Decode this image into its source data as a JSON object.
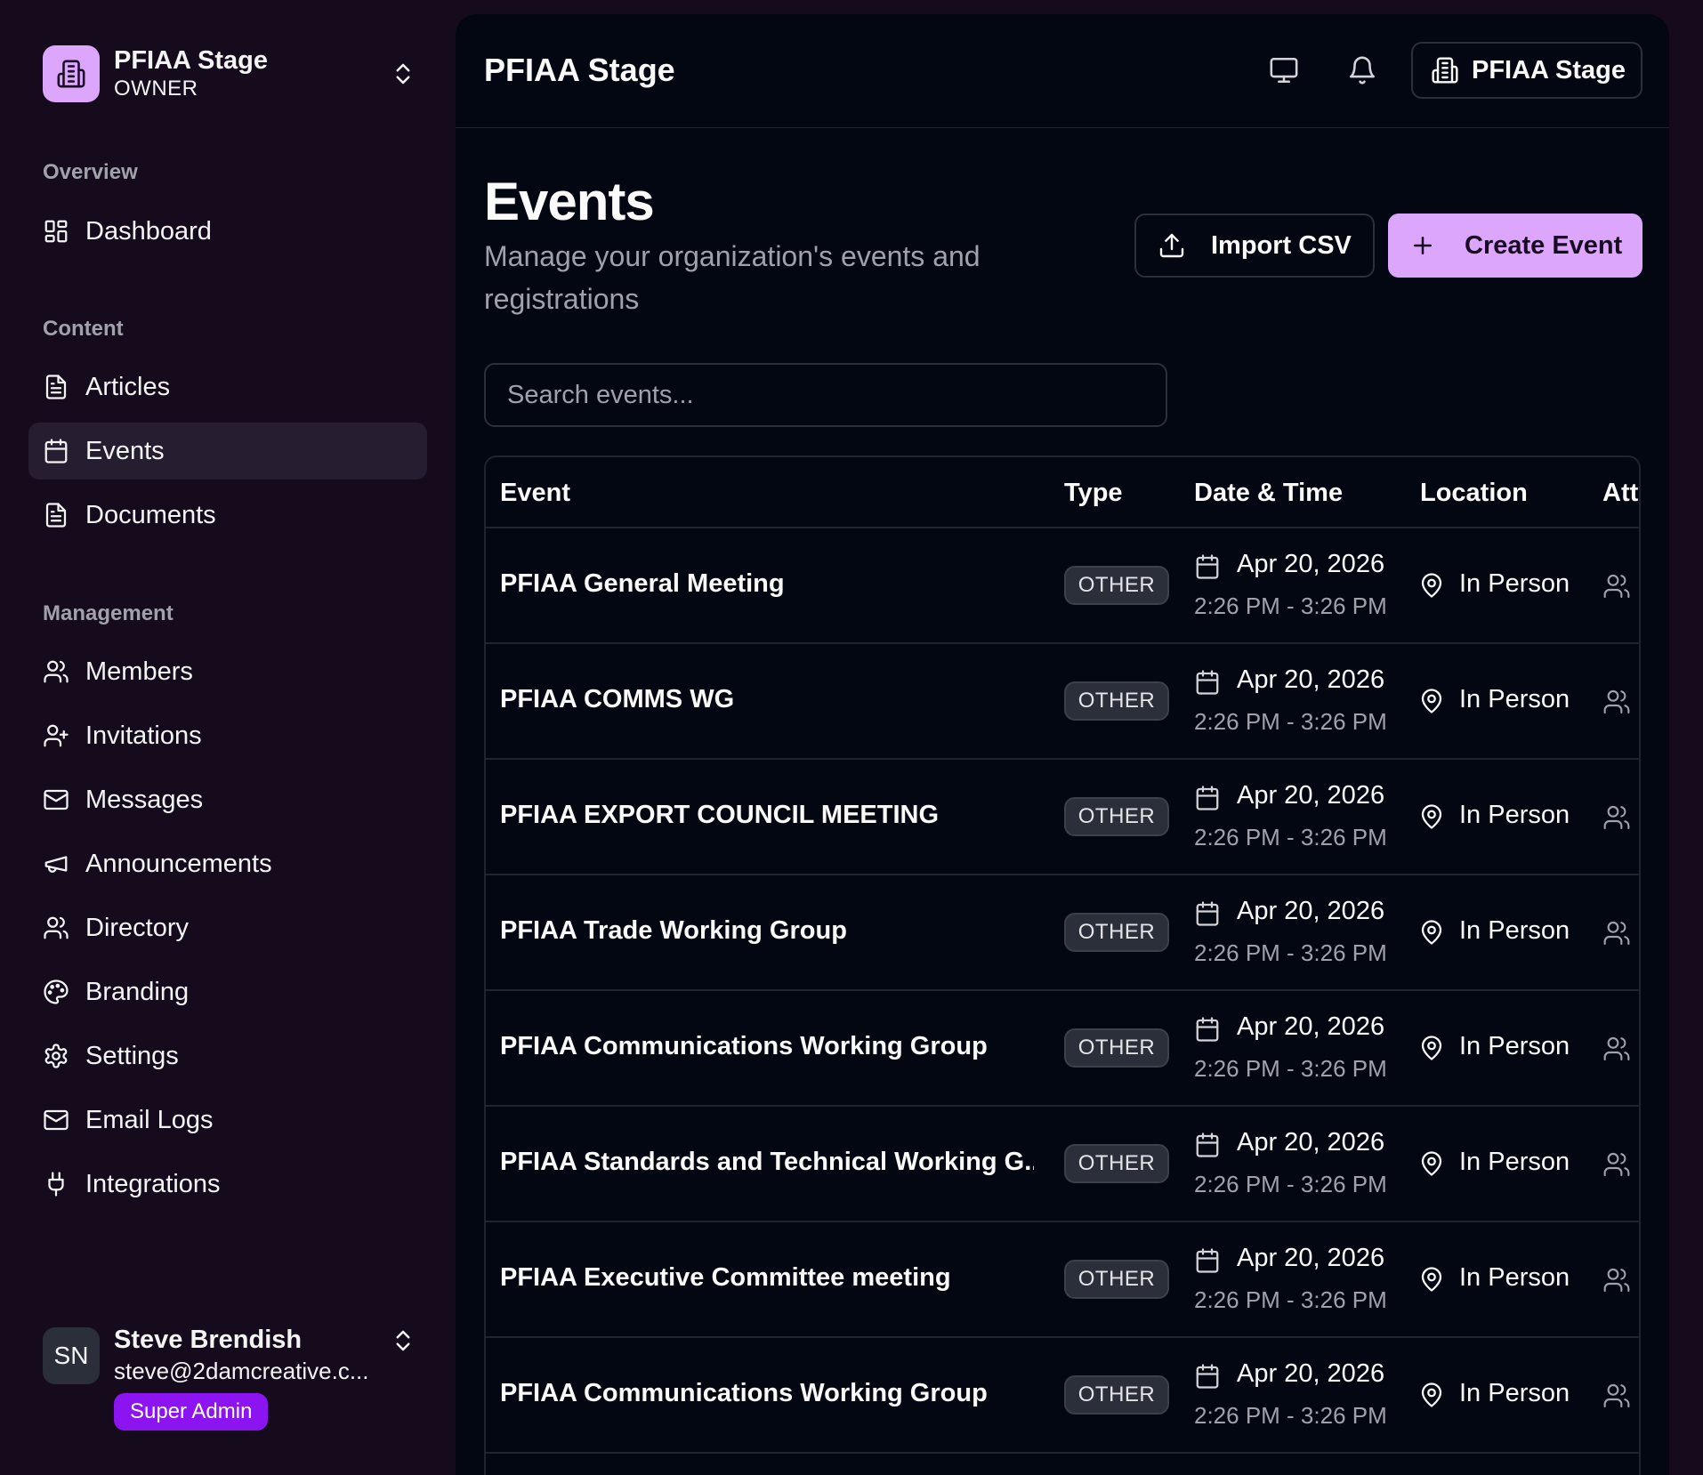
{
  "org": {
    "name": "PFIAA Stage",
    "role": "OWNER"
  },
  "nav": {
    "overview_label": "Overview",
    "content_label": "Content",
    "management_label": "Management",
    "dashboard": "Dashboard",
    "articles": "Articles",
    "events": "Events",
    "documents": "Documents",
    "members": "Members",
    "invitations": "Invitations",
    "messages": "Messages",
    "announcements": "Announcements",
    "directory": "Directory",
    "branding": "Branding",
    "settings": "Settings",
    "email_logs": "Email Logs",
    "integrations": "Integrations",
    "active": "events"
  },
  "user": {
    "initials": "SN",
    "name": "Steve Brendish",
    "email": "steve@2damcreative.c...",
    "badge": "Super Admin"
  },
  "header": {
    "title": "PFIAA Stage",
    "org_button": "PFIAA Stage",
    "icons": [
      "monitor-icon",
      "bell-icon",
      "building-icon"
    ]
  },
  "page": {
    "title": "Events",
    "subtitle": "Manage your organization's events and registrations",
    "import_label": "Import CSV",
    "create_label": "Create Event",
    "search_placeholder": "Search events..."
  },
  "table": {
    "columns": [
      "Event",
      "Type",
      "Date & Time",
      "Location",
      "Att"
    ],
    "rows": [
      {
        "name": "PFIAA General Meeting",
        "type": "OTHER",
        "date": "Apr 20, 2026",
        "time": "2:26 PM - 3:26 PM",
        "location": "In Person"
      },
      {
        "name": "PFIAA COMMS WG",
        "type": "OTHER",
        "date": "Apr 20, 2026",
        "time": "2:26 PM - 3:26 PM",
        "location": "In Person"
      },
      {
        "name": "PFIAA EXPORT COUNCIL MEETING",
        "type": "OTHER",
        "date": "Apr 20, 2026",
        "time": "2:26 PM - 3:26 PM",
        "location": "In Person"
      },
      {
        "name": "PFIAA Trade Working Group",
        "type": "OTHER",
        "date": "Apr 20, 2026",
        "time": "2:26 PM - 3:26 PM",
        "location": "In Person"
      },
      {
        "name": "PFIAA Communications Working Group",
        "type": "OTHER",
        "date": "Apr 20, 2026",
        "time": "2:26 PM - 3:26 PM",
        "location": "In Person"
      },
      {
        "name": "PFIAA Standards and Technical Working G...",
        "type": "OTHER",
        "date": "Apr 20, 2026",
        "time": "2:26 PM - 3:26 PM",
        "location": "In Person"
      },
      {
        "name": "PFIAA Executive Committee meeting",
        "type": "OTHER",
        "date": "Apr 20, 2026",
        "time": "2:26 PM - 3:26 PM",
        "location": "In Person"
      },
      {
        "name": "PFIAA Communications Working Group",
        "type": "OTHER",
        "date": "Apr 20, 2026",
        "time": "2:26 PM - 3:26 PM",
        "location": "In Person"
      }
    ]
  },
  "colors": {
    "sidebar_bg": "#150b1c",
    "main_bg": "#030712",
    "accent": "#dba6fb",
    "badge_purple": "#8b14f0",
    "muted_text": "#a1a1aa"
  }
}
